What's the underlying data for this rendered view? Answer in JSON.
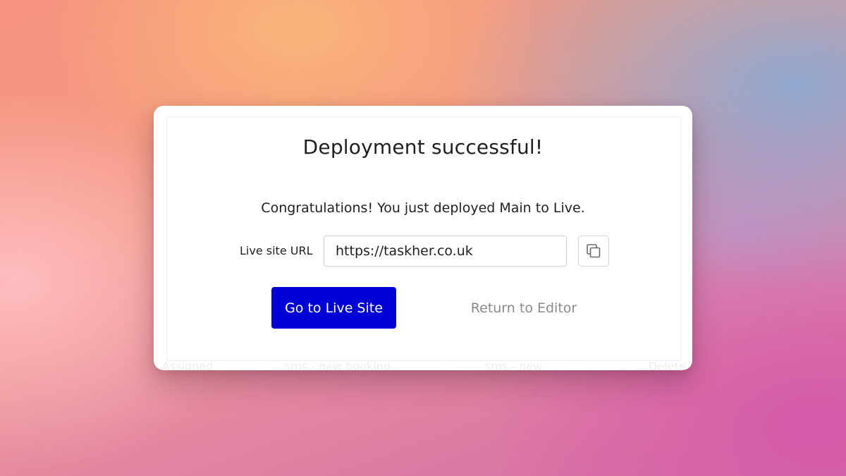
{
  "modal": {
    "title": "Deployment successful!",
    "message": "Congratulations! You just deployed Main to Live.",
    "url_label": "Live site URL",
    "url_value": "https://taskher.co.uk",
    "copy_icon": "copy-icon",
    "primary_button_label": "Go to Live Site",
    "secondary_button_label": "Return to Editor"
  },
  "background": {
    "ghost_labels": [
      "Assigned",
      "sms - new booking",
      "sms - new",
      "Delete"
    ]
  },
  "colors": {
    "primary": "#0000d4",
    "secondary_text": "#8a8a8a",
    "text": "#1f1f1f"
  }
}
